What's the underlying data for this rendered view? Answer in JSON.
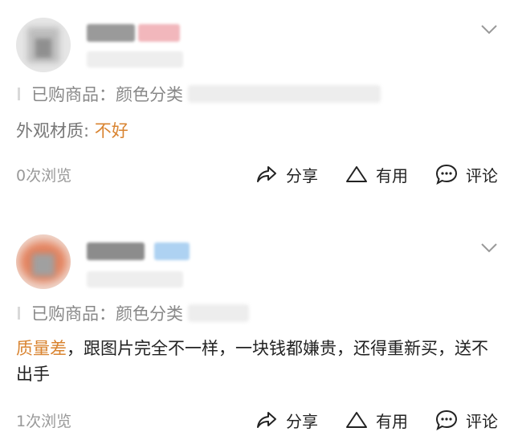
{
  "reviews": [
    {
      "purchased_label": "已购商品：",
      "purchased_value": "颜色分类",
      "spec_label": "外观材质:",
      "spec_value": "不好",
      "content_highlight": "",
      "content_text": "",
      "views": "0次浏览",
      "share_label": "分享",
      "useful_label": "有用",
      "comment_label": "评论"
    },
    {
      "purchased_label": "已购商品：",
      "purchased_value": "颜色分类",
      "spec_label": "",
      "spec_value": "",
      "content_highlight": "质量差",
      "content_text": "，跟图片完全不一样，一块钱都嫌贵，还得重新买，送不出手",
      "views": "1次浏览",
      "share_label": "分享",
      "useful_label": "有用",
      "comment_label": "评论"
    }
  ],
  "icons": {
    "share": "share-icon",
    "useful": "triangle-icon",
    "comment": "comment-icon",
    "expand": "chevron-down-icon"
  },
  "colors": {
    "accent": "#d98431",
    "muted": "#888888"
  }
}
